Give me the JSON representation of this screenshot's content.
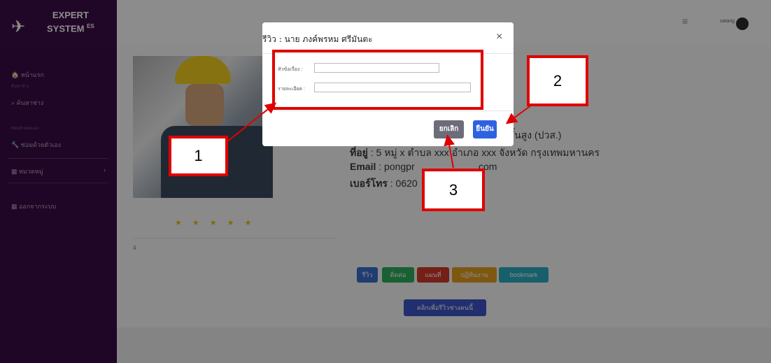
{
  "sidebar": {
    "logo": {
      "line1": "EXPERT",
      "line2": "SYSTEM",
      "sup": "ES"
    },
    "home": "หน้าแรก",
    "cap_search": "ค้นหาช่าง",
    "search": "ค้นหาช่าง",
    "cap_self": "ซ่อมด้วยตนเอง",
    "self_repair": "ซ่อมด้วยตัวเอง",
    "category": "หมวดหมู่",
    "logout": "ออกจากระบบ"
  },
  "topbar": {
    "menu_icon": "≡",
    "user": "satang"
  },
  "profile": {
    "address_label": "ที่อยู่",
    "address_value": " : 5 หมู่ x ตำบล xxx อำเภอ xxx จังหวัด กรุงเทพมหานคร",
    "email_label": "Email",
    "email_value": " : pongpr",
    "email_tail": "com",
    "phone_label": "เบอร์โทร",
    "phone_value": " : 0620",
    "edu_tail": "าชีพชั้นสูง (ปวส.)",
    "stars": "★ ★ ★ ★ ★",
    "rating": "4"
  },
  "actions": {
    "review": "รีวิว",
    "contact": "ติดต่อ",
    "map": "แผนที่",
    "work": "ปฏิทินงาน",
    "bookmark": "bookmark",
    "click_review": "คลิกเพื่อรีวิวช่างคนนี้"
  },
  "modal": {
    "title": "รีวิว : นาย ภงค์พรหม ศรีมันตะ",
    "close": "×",
    "subject_label": "หัวข้อเรื่อง :",
    "subject_value": "",
    "detail_label": "รายละเอียด :",
    "detail_value": "",
    "cancel": "ยกเลิก",
    "confirm": "ยืนยัน"
  },
  "annotations": {
    "n1": "1",
    "n2": "2",
    "n3": "3"
  },
  "colors": {
    "sidebar": "#3a0b45",
    "review_btn": "#3a6fcf",
    "contact_btn": "#2eaf5c",
    "map_btn": "#d53a2b",
    "work_btn": "#e5a020",
    "bookmark_btn": "#2ab0c4",
    "cancel_btn": "#6c6c7a",
    "confirm_btn": "#2f62e0",
    "annotation": "#e00000"
  }
}
